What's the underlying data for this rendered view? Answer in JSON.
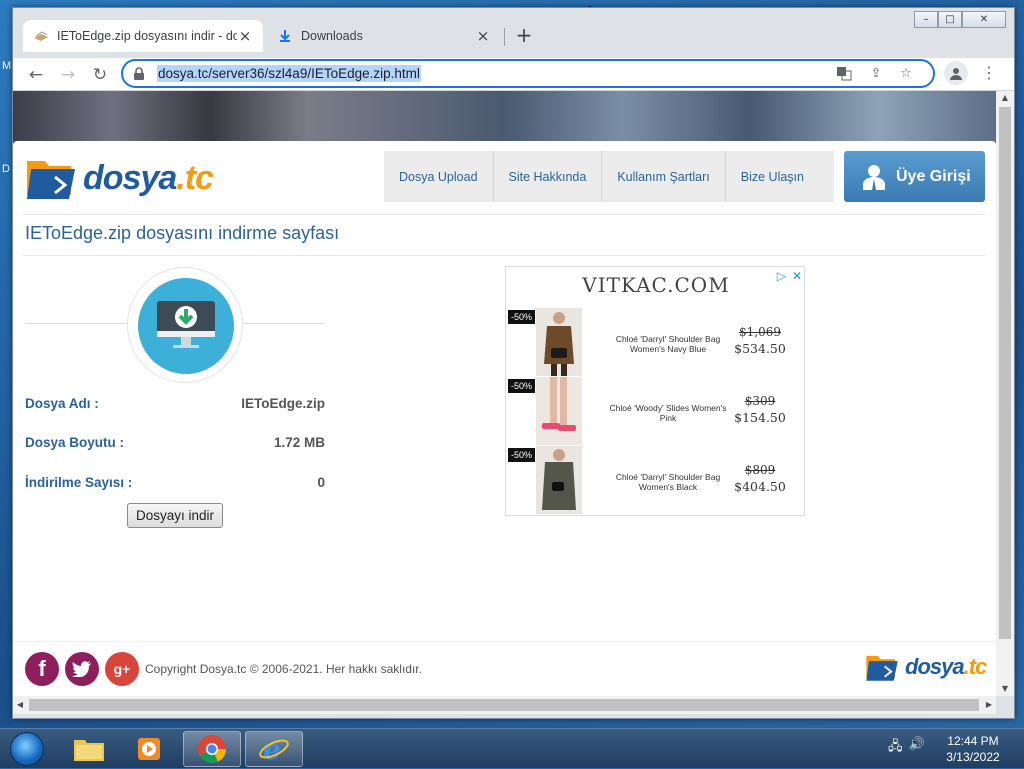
{
  "browser": {
    "tabs": [
      {
        "title": "IEToEdge.zip dosyasını indir - do",
        "close": "×"
      },
      {
        "title": "Downloads",
        "close": "×"
      }
    ],
    "new_tab": "+",
    "url": "dosya.tc/server36/szl4a9/IEToEdge.zip.html",
    "window_buttons": {
      "minimize": "–",
      "maximize": "□",
      "close": "✕"
    }
  },
  "site": {
    "logo": {
      "main": "dosya",
      "suffix": ".tc"
    },
    "nav": [
      "Dosya Upload",
      "Site Hakkında",
      "Kullanım Şartları",
      "Bize Ulaşın"
    ],
    "login_label": "Üye Girişi",
    "page_title": "IEToEdge.zip dosyasını indirme sayfası",
    "file_info": [
      {
        "label": "Dosya Adı :",
        "value": "IEToEdge.zip"
      },
      {
        "label": "Dosya Boyutu :",
        "value": "1.72 MB"
      },
      {
        "label": "İndirilme Sayısı :",
        "value": "0"
      }
    ],
    "download_button": "Dosyayı indir",
    "footer": {
      "copyright": "Copyright Dosya.tc © 2006-2021. Her hakkı saklıdır.",
      "social": [
        "f",
        "t",
        "g+"
      ]
    }
  },
  "ad": {
    "brand": "VITKAC.COM",
    "items": [
      {
        "badge": "-50%",
        "name": "Chloé 'Darryl' Shoulder Bag Women's Navy Blue",
        "old_price": "$1,069",
        "new_price": "$534.50"
      },
      {
        "badge": "-50%",
        "name": "Chloé 'Woody' Slides Women's Pink",
        "old_price": "$309",
        "new_price": "$154.50"
      },
      {
        "badge": "-50%",
        "name": "Chloé 'Darryl' Shoulder Bag Women's Black",
        "old_price": "$809",
        "new_price": "$404.50"
      }
    ]
  },
  "taskbar": {
    "clock_time": "12:44 PM",
    "clock_date": "3/13/2022"
  },
  "desktop": {
    "left_text_1": "M",
    "left_text_2": "D"
  },
  "colors": {
    "accent": "#1a73e8",
    "site_blue": "#2a6397",
    "logo_orange": "#f39c12",
    "download_teal": "#3cb0d8"
  }
}
